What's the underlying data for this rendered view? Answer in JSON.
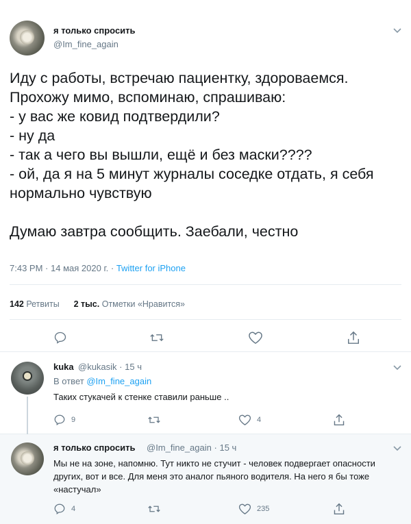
{
  "main_tweet": {
    "display_name": "я только спросить",
    "handle": "@Im_fine_again",
    "text": "Иду с работы, встречаю пациентку, здороваемся.\nПрохожу мимо, вспоминаю, спрашиваю:\n- у вас же ковид подтвердили?\n- ну да\n- так а чего вы вышли, ещё и без маски????\n- ой, да я на 5 минут журналы соседке отдать, я себя\nнормально чувствую\n\nДумаю завтра сообщить. Заебали, честно",
    "time": "7:43 PM",
    "date": "14 мая 2020 г.",
    "source": "Twitter for iPhone",
    "retweets_count": "142",
    "retweets_label": "Ретвиты",
    "likes_count": "2 тыс.",
    "likes_label": "Отметки «Нравится»"
  },
  "replies": [
    {
      "display_name": "kuka",
      "handle": "@kukasik",
      "age": "15 ч",
      "in_reply_label": "В ответ",
      "in_reply_mention": "@Im_fine_again",
      "text": "Таких стукачей к стенке ставили раньше ..",
      "reply_count": "9",
      "retweet_count": "",
      "like_count": "4"
    },
    {
      "display_name": "я только спросить",
      "handle": "@Im_fine_again",
      "age": "15 ч",
      "text": "Мы не на зоне, напомню. Тут никто не стучит - человек подвергает опасности других, вот и все. Для меня это аналог пьяного водителя. На него я бы тоже «настучал»",
      "reply_count": "4",
      "retweet_count": "",
      "like_count": "235"
    }
  ],
  "separator_dot": "·",
  "icons": {
    "reply": "reply-icon",
    "retweet": "retweet-icon",
    "like": "heart-icon",
    "share": "share-icon",
    "menu": "chevron-down-icon"
  },
  "colors": {
    "text": "#14171a",
    "muted": "#657786",
    "link": "#1da1f2",
    "divider": "#e6ecf0"
  }
}
